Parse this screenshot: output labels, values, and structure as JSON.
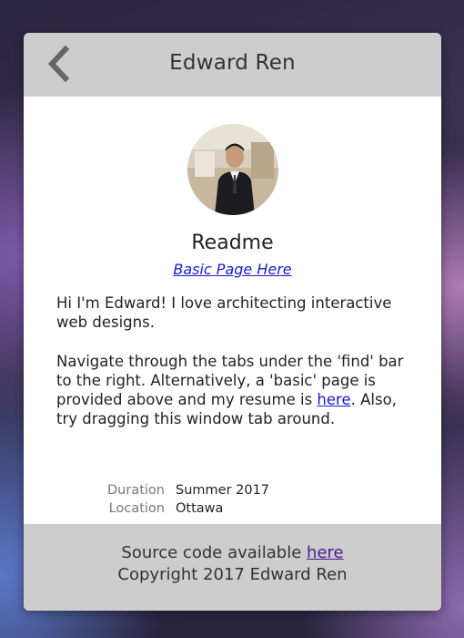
{
  "window": {
    "title": "Edward Ren"
  },
  "profile": {
    "heading": "Readme",
    "basic_link": "Basic Page Here"
  },
  "about": {
    "intro": "Hi I'm Edward! I love architecting interactive web designs.",
    "nav_text_1": "Navigate through the tabs under the 'find' bar to the right. Alternatively, a 'basic' page is provided above and my resume is ",
    "resume_link": "here",
    "nav_text_2": ". Also, try dragging this window tab around."
  },
  "meta": [
    {
      "key": "Duration",
      "value": "Summer 2017"
    },
    {
      "key": "Location",
      "value": "Ottawa"
    }
  ],
  "footer": {
    "source_text": "Source code available ",
    "source_link": "here",
    "copyright": "Copyright 2017 Edward Ren"
  }
}
